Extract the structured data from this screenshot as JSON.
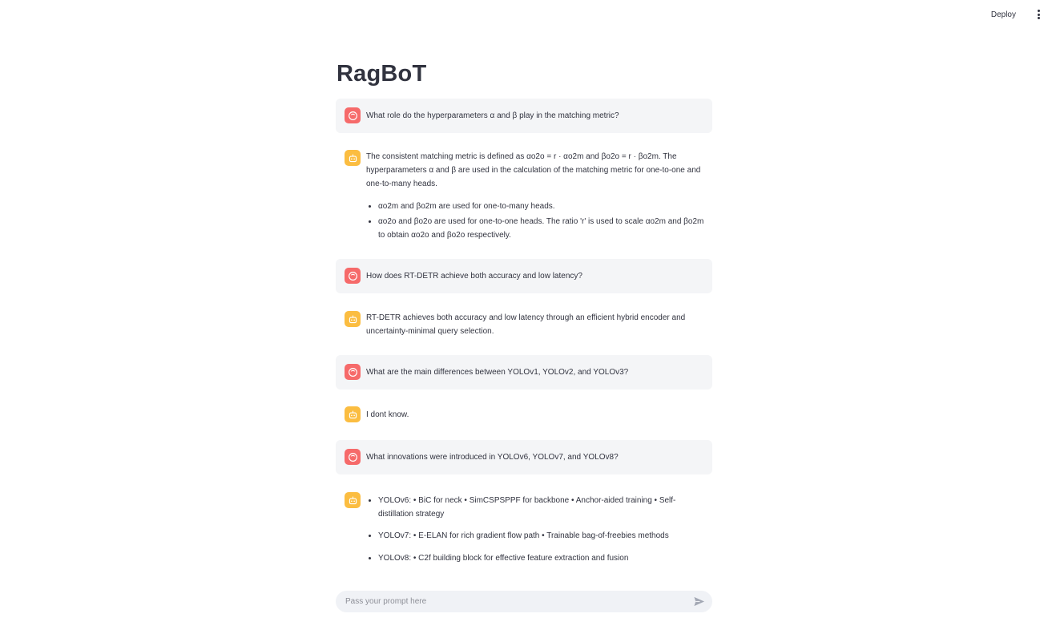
{
  "toolbar": {
    "deploy_label": "Deploy",
    "menu_icon": "more-vert-icon"
  },
  "app": {
    "title": "RagBoT"
  },
  "messages": [
    {
      "role": "user",
      "icon": "user-face-icon",
      "text": "What role do the hyperparameters α and β play in the matching metric?"
    },
    {
      "role": "assistant",
      "icon": "robot-icon",
      "paragraph": "The consistent matching metric is defined as αo2o = r · αo2m and βo2o = r · βo2m. The hyperparameters α and β are used in the calculation of the matching metric for one-to-one and one-to-many heads.",
      "bullets": [
        "αo2m and βo2m are used for one-to-many heads.",
        "αo2o and βo2o are used for one-to-one heads. The ratio 'r' is used to scale αo2m and βo2m to obtain αo2o and βo2o respectively."
      ]
    },
    {
      "role": "user",
      "icon": "user-face-icon",
      "text": "How does RT-DETR achieve both accuracy and low latency?"
    },
    {
      "role": "assistant",
      "icon": "robot-icon",
      "text": "RT-DETR achieves both accuracy and low latency through an efficient hybrid encoder and uncertainty-minimal query selection."
    },
    {
      "role": "user",
      "icon": "user-face-icon",
      "text": "What are the main differences between YOLOv1, YOLOv2, and YOLOv3?"
    },
    {
      "role": "assistant",
      "icon": "robot-icon",
      "text": "I dont know."
    },
    {
      "role": "user",
      "icon": "user-face-icon",
      "text": "What innovations were introduced in YOLOv6, YOLOv7, and YOLOv8?"
    },
    {
      "role": "assistant",
      "icon": "robot-icon",
      "bullets": [
        "YOLOv6: • BiC for neck • SimCSPSPPF for backbone • Anchor-aided training • Self-distillation strategy",
        "YOLOv7: • E-ELAN for rich gradient flow path • Trainable bag-of-freebies methods",
        "YOLOv8: • C2f building block for effective feature extraction and fusion"
      ]
    }
  ],
  "chat_input": {
    "placeholder": "Pass your prompt here",
    "value": "",
    "send_icon": "send-icon"
  },
  "colors": {
    "user_avatar": "#f66a6a",
    "assistant_avatar": "#fbbd41",
    "user_bubble": "#f4f5f7",
    "text": "#31333f"
  }
}
